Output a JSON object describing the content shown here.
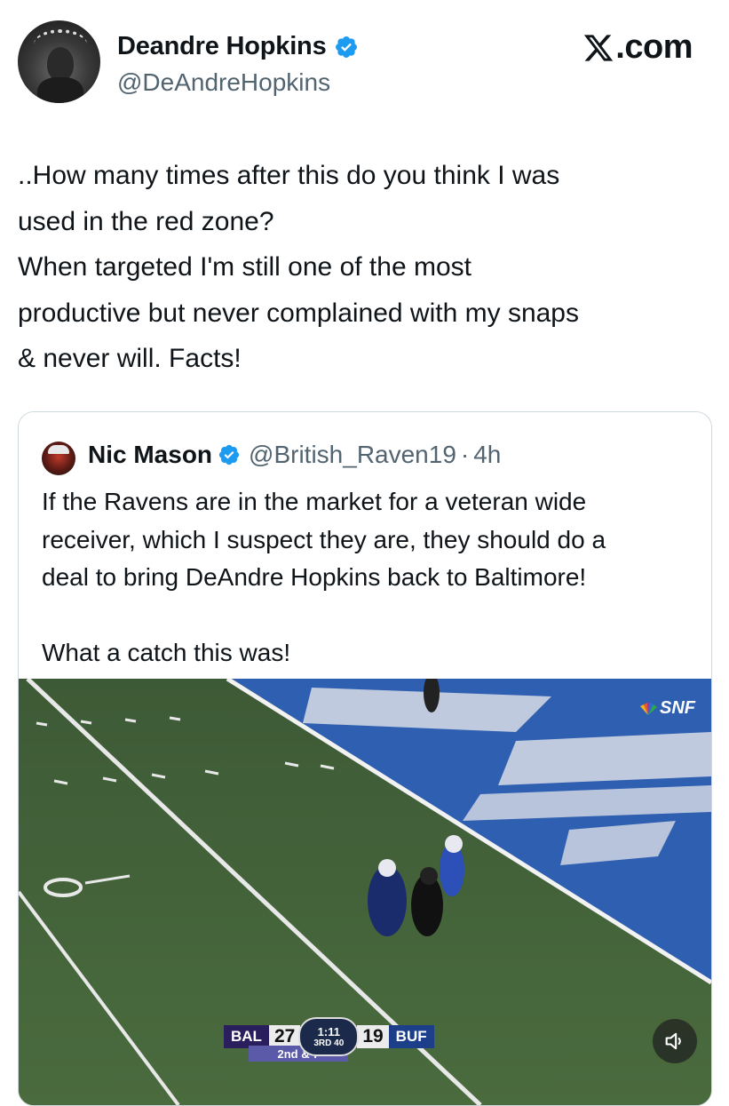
{
  "author": {
    "display_name": "Deandre Hopkins",
    "handle": "@DeAndreHopkins",
    "verified": true
  },
  "brand": {
    "label": ".com",
    "logo_icon": "x-logo-icon"
  },
  "tweet": {
    "text": "..How many times after this do you think I was\nused in the red zone?\nWhen targeted I'm still one of the most\nproductive but never complained with my snaps\n& never will. Facts!"
  },
  "quoted_tweet": {
    "display_name": "Nic Mason",
    "handle": "@British_Raven19",
    "separator": "·",
    "time": "4h",
    "verified": true,
    "text": "If the Ravens are in the market for a veteran wide\nreceiver, which I suspect they are, they should do a\ndeal to bring DeAndre Hopkins back to Baltimore!\n\nWhat a catch this was!",
    "video": {
      "network_label": "SNF",
      "scoreboard": {
        "away_team": "BAL",
        "away_score": "27",
        "clock": "1:11",
        "quarter": "3RD",
        "play_clock": "40",
        "home_score": "19",
        "home_team": "BUF",
        "down_distance": "2nd & 7"
      },
      "mute_icon": "speaker-muted-icon"
    }
  },
  "colors": {
    "verified_blue": "#1d9bf0",
    "secondary_text": "#536471",
    "text": "#0f1419"
  }
}
